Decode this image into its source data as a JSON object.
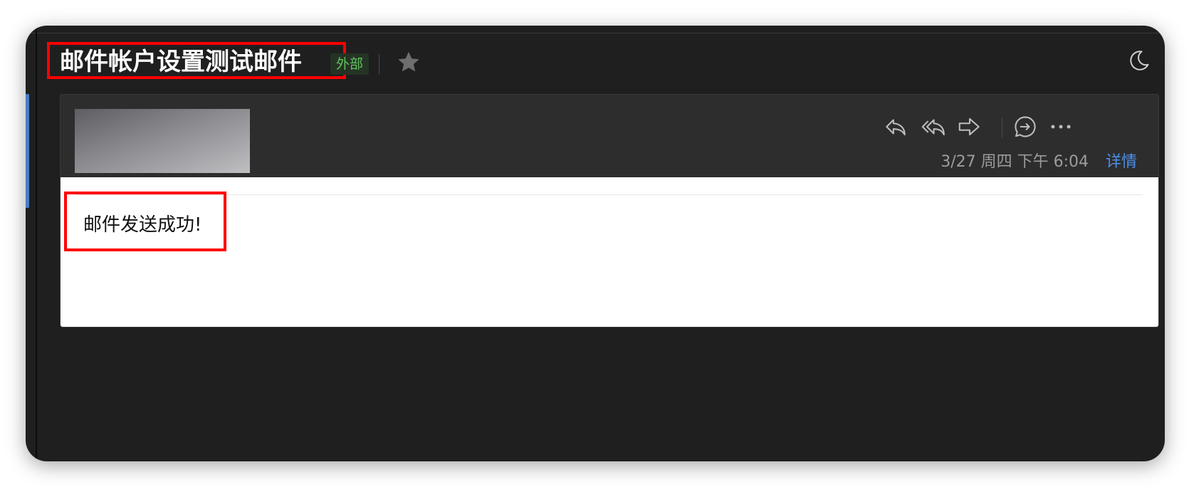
{
  "email": {
    "subject": "邮件帐户设置测试邮件",
    "tag": "外部",
    "datetime": "3/27 周四 下午 6:04",
    "details_label": "详情",
    "body": "邮件发送成功!"
  },
  "icons": [
    "star-icon",
    "moon-icon",
    "reply-icon",
    "reply-all-icon",
    "forward-icon",
    "comment-icon",
    "more-icon"
  ],
  "colors": {
    "window_bg": "#1f1f1f",
    "card_header_bg": "#2d2d2d",
    "tag_text": "#63c35e",
    "link": "#4d8fe6",
    "highlight": "#ff0000"
  }
}
